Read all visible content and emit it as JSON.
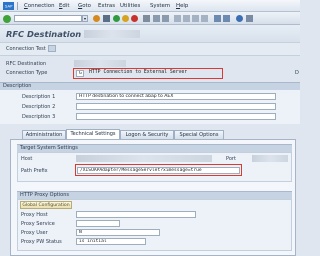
{
  "menu": {
    "items": [
      {
        "underline": "C",
        "rest": "onnection"
      },
      {
        "underline": "E",
        "rest": "dit"
      },
      {
        "underline": "G",
        "rest": "oto"
      },
      {
        "underline": "",
        "rest": "Extras"
      },
      {
        "underline": "",
        "rest": "Utilities"
      },
      {
        "underline": "",
        "rest": "System"
      },
      {
        "underline": "H",
        "rest": "elp"
      }
    ]
  },
  "page": {
    "title": "RFC Destination"
  },
  "connection_test_label": "Connection Test",
  "header_fields": {
    "rfc_destination_label": "RFC Destination",
    "connection_type_label": "Connection Type",
    "connection_type_code": "G",
    "connection_type_text": "HTTP Connection to External Server",
    "connection_type_trail": "D"
  },
  "description": {
    "section_title": "Description",
    "desc1_label": "Description 1",
    "desc1_value": "HTTP destination to connect abap to AEX",
    "desc2_label": "Description 2",
    "desc3_label": "Description 3"
  },
  "tabs": [
    "Administration",
    "Technical Settings",
    "Logon & Security",
    "Special Options"
  ],
  "target": {
    "section_title": "Target System Settings",
    "host_label": "Host",
    "port_label": "Port",
    "path_prefix_label": "Path Prefix",
    "path_prefix_value": "/XISOAPAdapter/MessageServlet?ximessage=true"
  },
  "proxy": {
    "section_title": "HTTP Proxy Options",
    "global_config_label": "Global Configuration",
    "proxy_host_label": "Proxy Host",
    "proxy_service_label": "Proxy Service",
    "proxy_user_label": "Proxy User",
    "proxy_user_value": "N",
    "proxy_pw_label": "Proxy PW Status",
    "proxy_pw_value": "is initial"
  }
}
